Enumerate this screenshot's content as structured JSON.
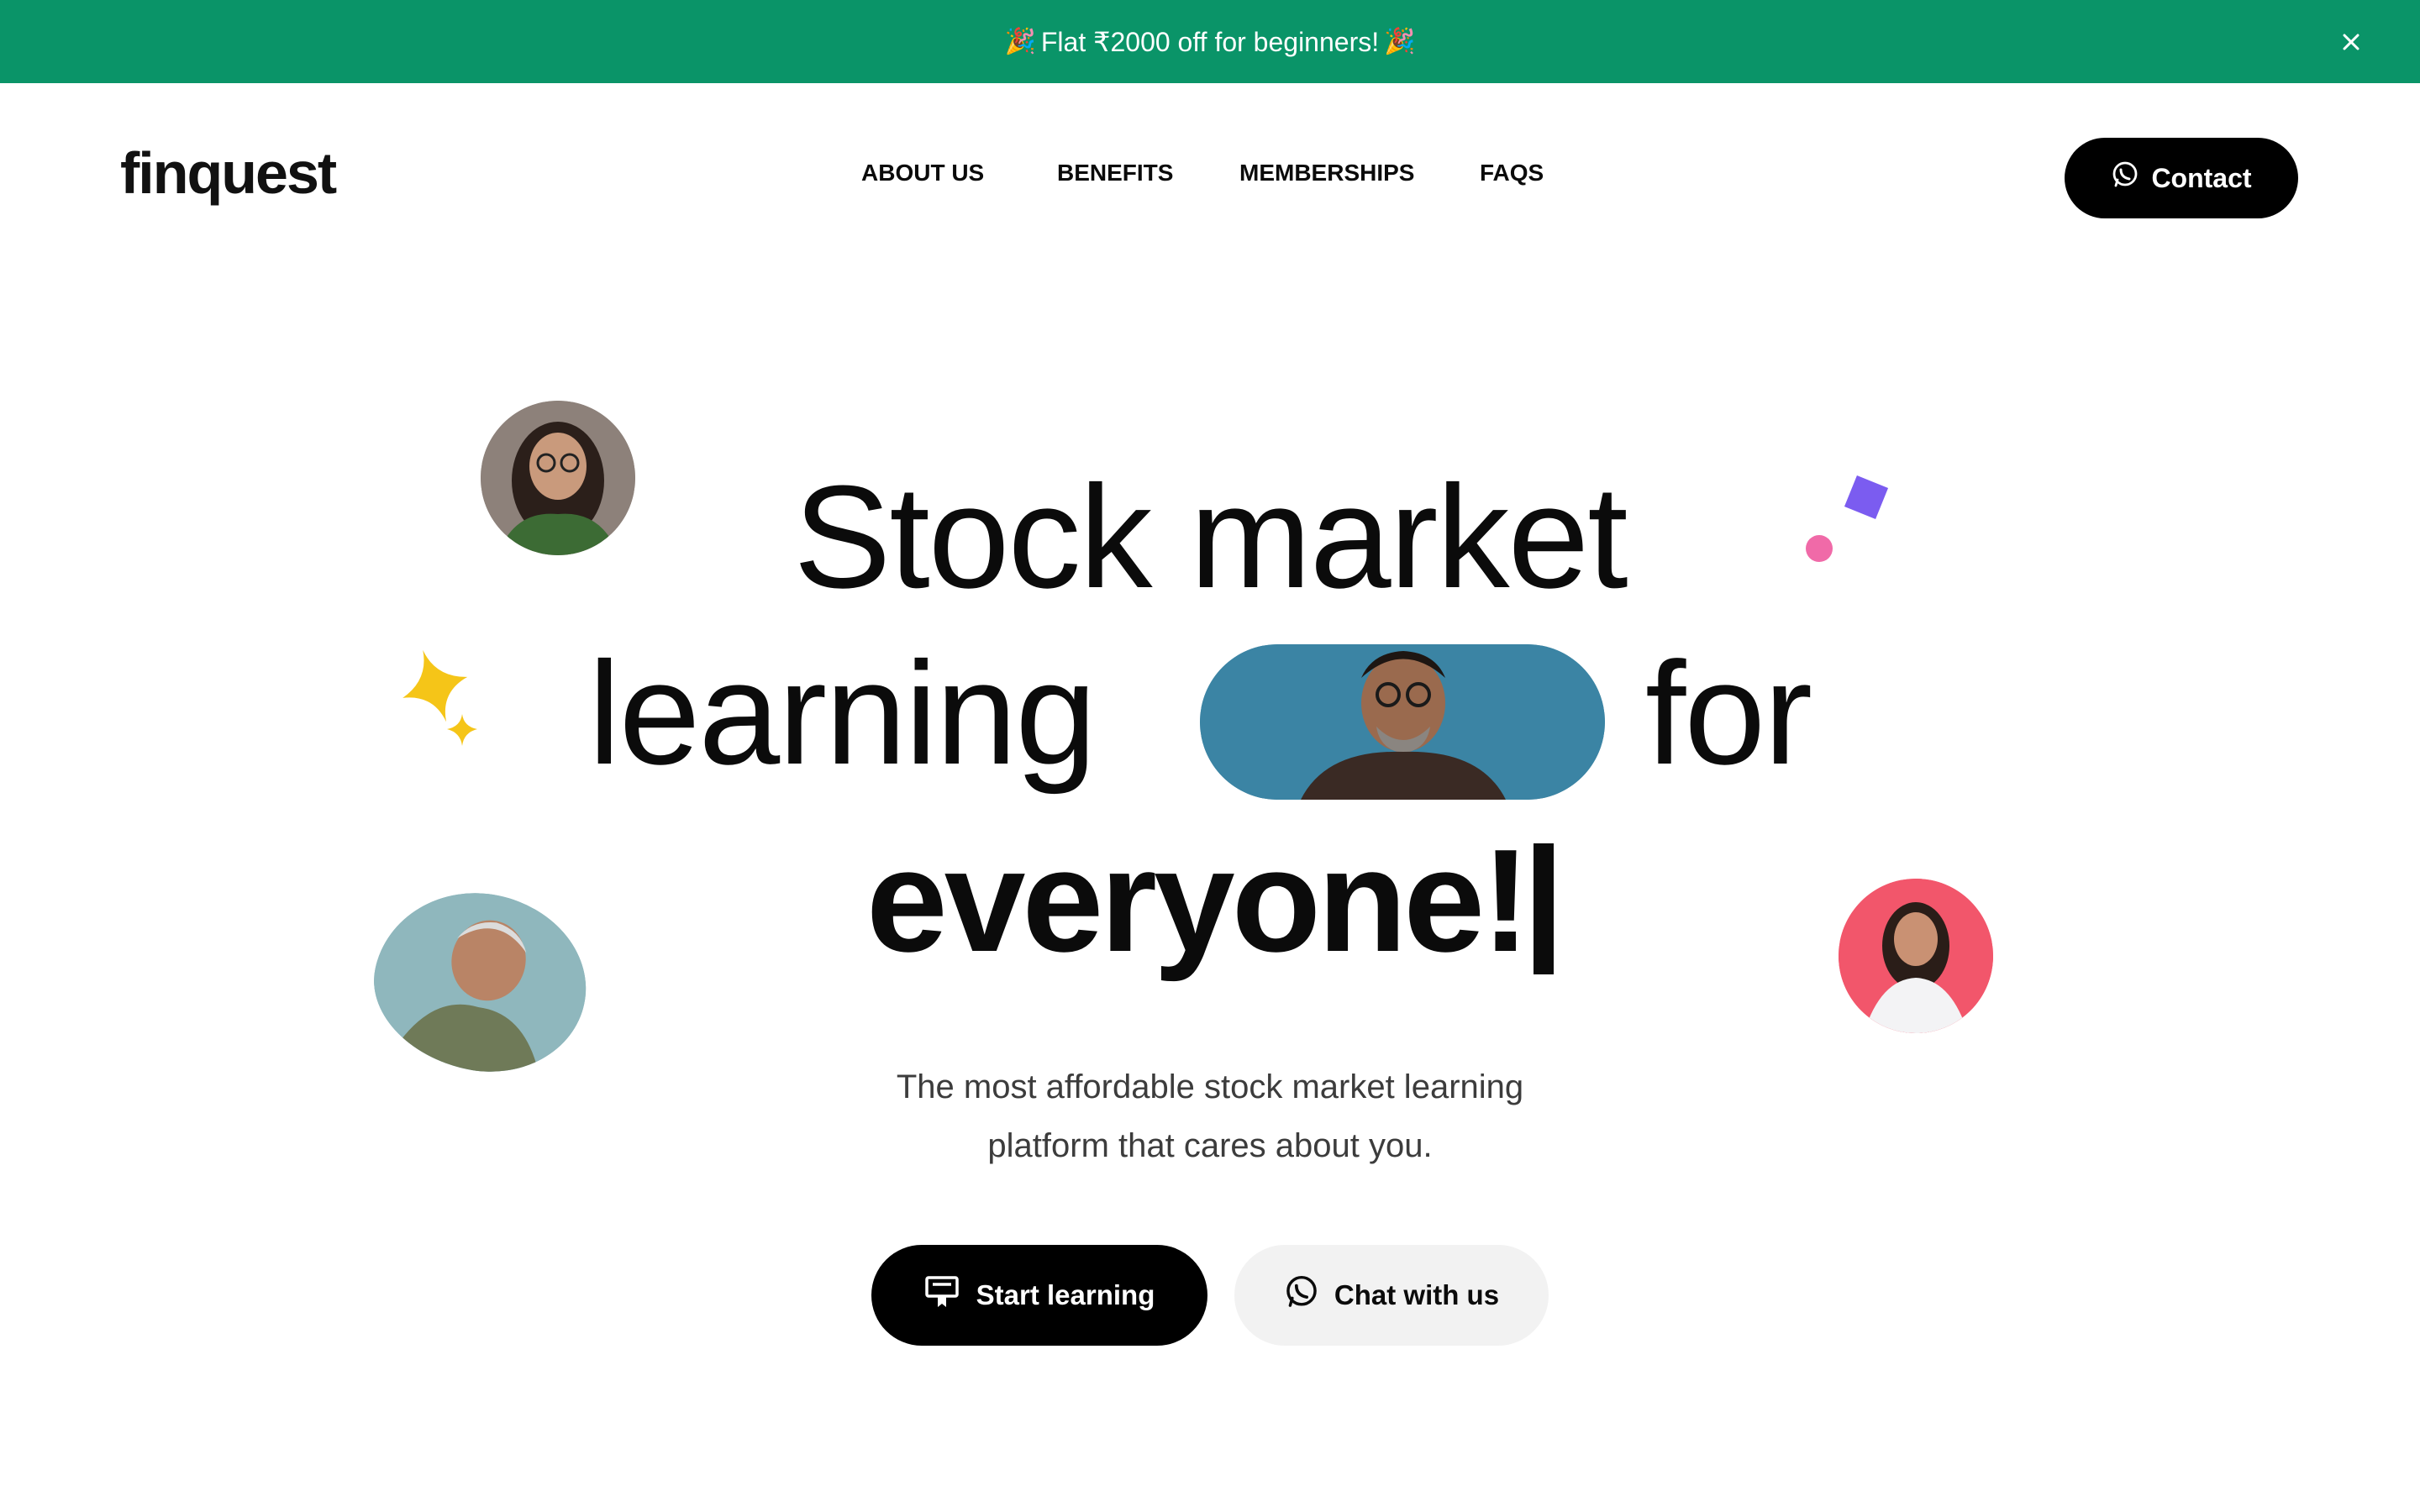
{
  "banner": {
    "text": "Flat ₹2000 off for beginners!",
    "emoji_left": "🎉",
    "emoji_right": "🎉",
    "close_icon": "close-icon",
    "color": "#0a9468"
  },
  "header": {
    "logo": "finquest",
    "nav": [
      {
        "label": "ABOUT US"
      },
      {
        "label": "BENEFITS"
      },
      {
        "label": "MEMBERSHIPS"
      },
      {
        "label": "FAQS"
      }
    ],
    "contact_label": "Contact",
    "contact_icon": "whatsapp-icon"
  },
  "hero": {
    "line1": "Stock market",
    "line2_left": "learning",
    "line2_right": "for",
    "line3": "everyone!",
    "subtitle_line1": "The most affordable stock market learning",
    "subtitle_line2": "platform that cares about you.",
    "primary_button": "Start learning",
    "primary_icon": "certificate-icon",
    "secondary_button": "Chat with us",
    "secondary_icon": "whatsapp-icon"
  },
  "colors": {
    "accent_green": "#0a9468",
    "sparkle_yellow": "#f5c518",
    "confetti_purple": "#7b5cf0",
    "confetti_pink": "#f06aa8",
    "avatar_pink_bg": "#f2566b",
    "avatar_teal_bg": "#8fb7bd"
  }
}
